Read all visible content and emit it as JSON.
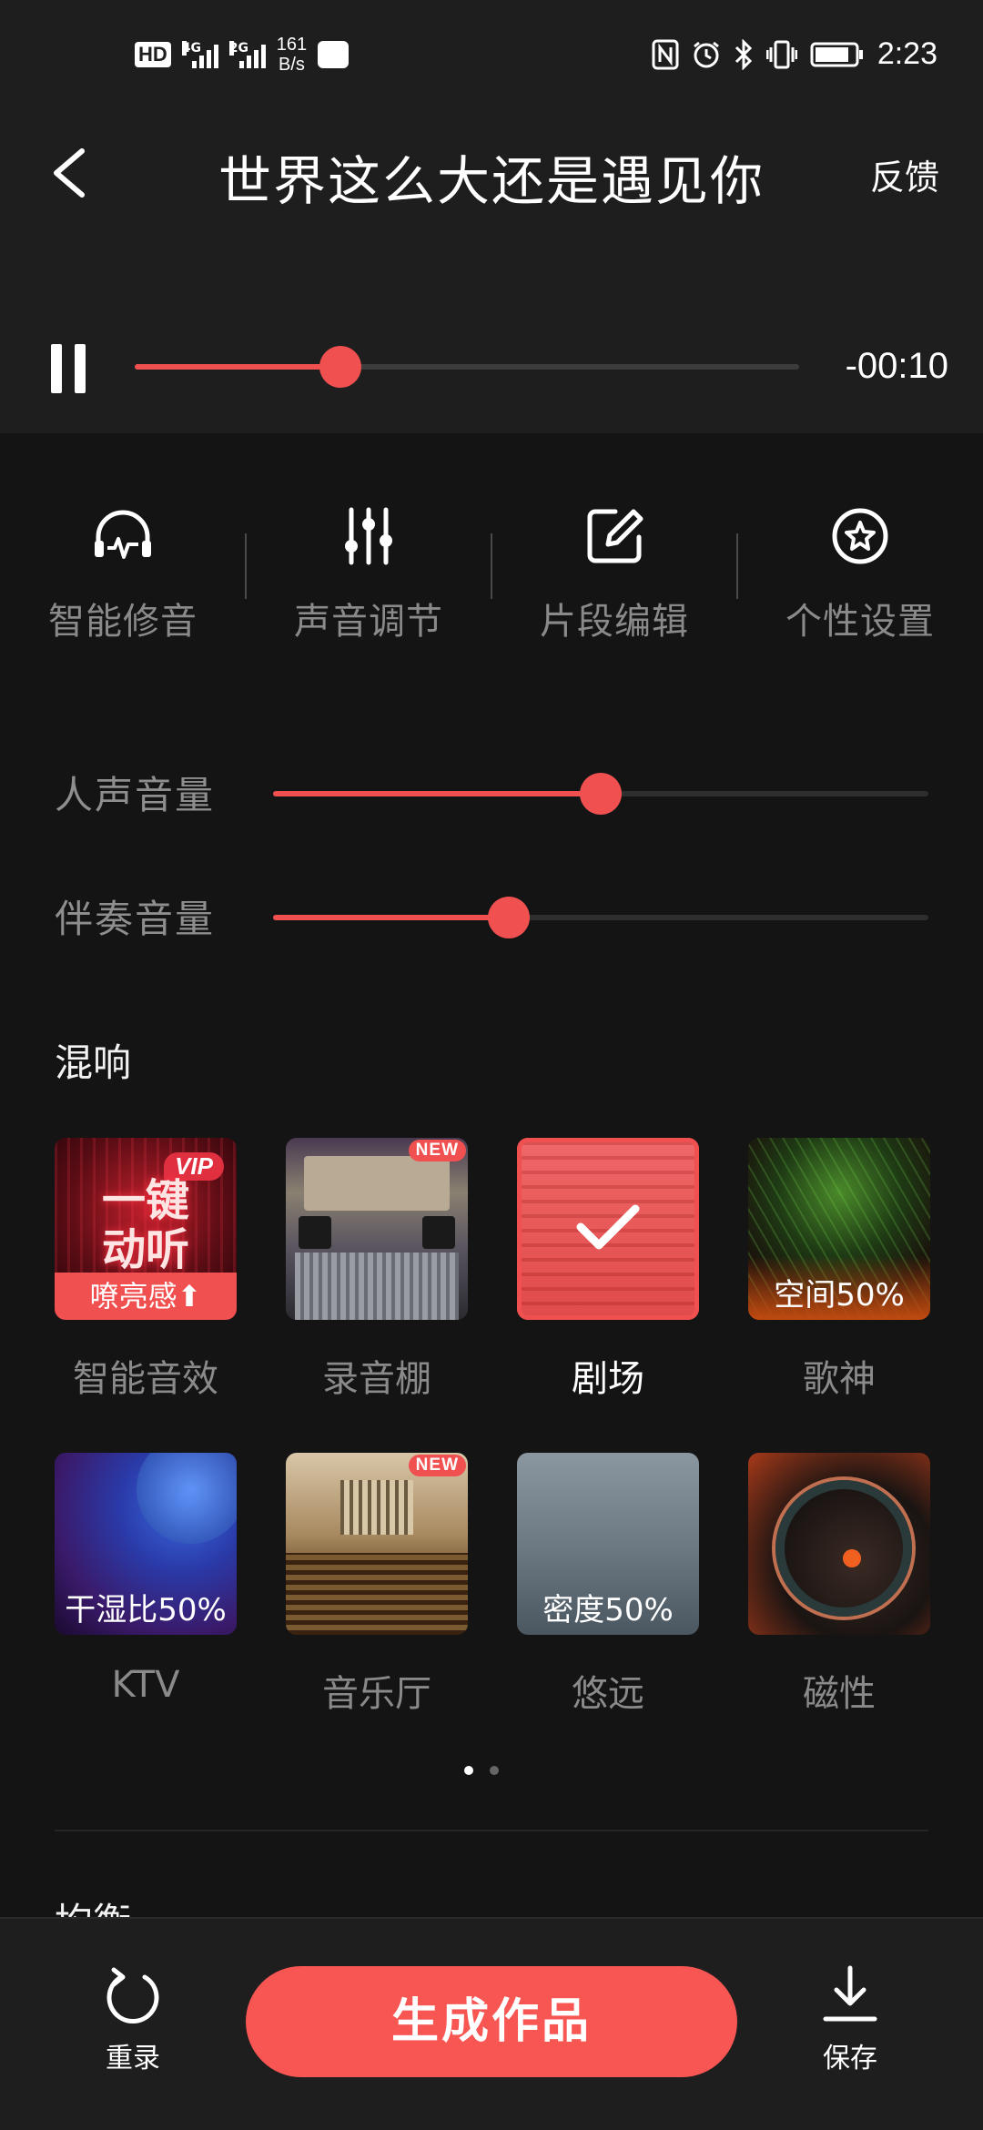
{
  "status_bar": {
    "hd": "HD",
    "sim1": "4G",
    "sim2": "2G",
    "net_speed_value": "161",
    "net_speed_unit": "B/s",
    "time": "2:23",
    "icons": [
      "nfc-icon",
      "alarm-icon",
      "bluetooth-icon",
      "vibrate-icon",
      "battery-icon"
    ]
  },
  "nav": {
    "back_icon": "chevron-left-icon",
    "title": "世界这么大还是遇见你",
    "feedback": "反馈"
  },
  "player": {
    "state_icon": "pause-icon",
    "progress": 0.31,
    "remaining_time": "-00:10"
  },
  "tools": [
    {
      "label": "智能修音",
      "icon": "headphones-wave-icon"
    },
    {
      "label": "声音调节",
      "icon": "mixer-sliders-icon"
    },
    {
      "label": "片段编辑",
      "icon": "edit-icon"
    },
    {
      "label": "个性设置",
      "icon": "star-badge-icon"
    }
  ],
  "sliders": [
    {
      "label": "人声音量",
      "value": 0.5
    },
    {
      "label": "伴奏音量",
      "value": 0.36
    }
  ],
  "reverb": {
    "title": "混响",
    "items": [
      {
        "label": "智能音效",
        "vip_badge": "VIP",
        "thumb_title_line1": "一键",
        "thumb_title_line2": "动听",
        "thumb_bar": "嘹亮感⬆"
      },
      {
        "label": "录音棚",
        "badge": "NEW"
      },
      {
        "label": "剧场",
        "selected": true
      },
      {
        "label": "歌神",
        "thumb_text": "空间50%"
      },
      {
        "label": "KTV",
        "thumb_text": "干湿比50%"
      },
      {
        "label": "音乐厅",
        "badge": "NEW"
      },
      {
        "label": "悠远",
        "thumb_text": "密度50%"
      },
      {
        "label": "磁性"
      }
    ],
    "page_count": 2,
    "current_page": 1
  },
  "next_section_title": "均衡",
  "bottom": {
    "rerecord": "重录",
    "generate": "生成作品",
    "save": "保存"
  },
  "colors": {
    "accent": "#f0504f",
    "background": "#141414",
    "panel": "#1e1e1e"
  }
}
